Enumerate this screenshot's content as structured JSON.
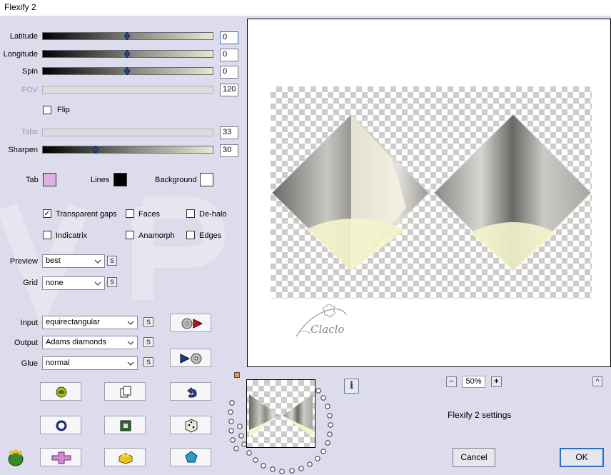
{
  "window": {
    "title": "Flexify 2"
  },
  "controls": {
    "latitude": {
      "label": "Latitude",
      "value": "0",
      "level": 0.5
    },
    "longitude": {
      "label": "Longitude",
      "value": "0",
      "level": 0.5
    },
    "spin": {
      "label": "Spin",
      "value": "0",
      "level": 0.5
    },
    "fov": {
      "label": "FOV",
      "value": "120"
    },
    "flip": {
      "label": "Flip",
      "checked": false
    },
    "tabs": {
      "label": "Tabs",
      "value": "33"
    },
    "sharpen": {
      "label": "Sharpen",
      "value": "30",
      "level": 0.3
    }
  },
  "colors": {
    "tab": {
      "label": "Tab",
      "color": "#e0b0e0"
    },
    "lines": {
      "label": "Lines",
      "color": "#000000"
    },
    "background": {
      "label": "Background",
      "color": "#ffffff"
    }
  },
  "options": {
    "transparent_gaps": {
      "label": "Transparent gaps",
      "checked": true
    },
    "faces": {
      "label": "Faces",
      "checked": false
    },
    "de_halo": {
      "label": "De-halo",
      "checked": false
    },
    "indicatrix": {
      "label": "Indicatrix",
      "checked": false
    },
    "anamorph": {
      "label": "Anamorph",
      "checked": false
    },
    "edges": {
      "label": "Edges",
      "checked": false
    }
  },
  "selects": {
    "preview": {
      "label": "Preview",
      "value": "best"
    },
    "grid": {
      "label": "Grid",
      "value": "none"
    },
    "input": {
      "label": "Input",
      "value": "equirectangular"
    },
    "output": {
      "label": "Output",
      "value": "Adams diamonds"
    },
    "glue": {
      "label": "Glue",
      "value": "normal"
    }
  },
  "small_button_label": "S",
  "zoom": {
    "value": "50%",
    "minus": "−",
    "plus": "+"
  },
  "settings_label": "Flexify 2 settings",
  "info_label": "i",
  "collapse_label": "^",
  "buttons": {
    "cancel": "Cancel",
    "ok": "OK"
  },
  "watermark": "Claclo",
  "accent": "#2a6cc8"
}
